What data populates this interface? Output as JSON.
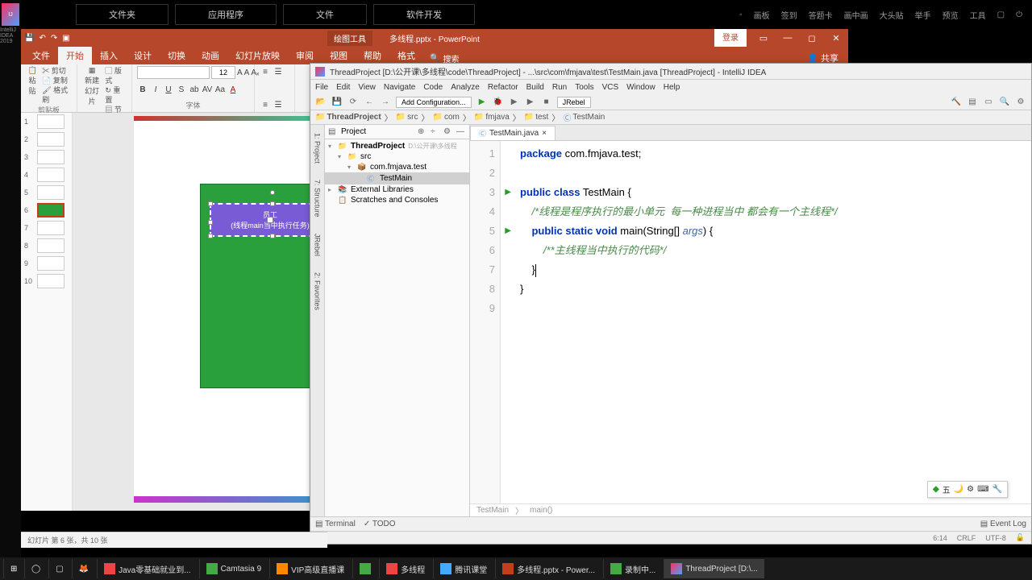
{
  "top_tabs": [
    "文件夹",
    "应用程序",
    "文件",
    "软件开发"
  ],
  "top_right": [
    "画板",
    "签到",
    "答题卡",
    "画中画",
    "大头贴",
    "举手",
    "预览",
    "工具"
  ],
  "ppt": {
    "tools_label": "绘图工具",
    "title": "多线程.pptx - PowerPoint",
    "login": "登录",
    "tabs": [
      "文件",
      "开始",
      "插入",
      "设计",
      "切换",
      "动画",
      "幻灯片放映",
      "审阅",
      "视图",
      "帮助",
      "格式"
    ],
    "search_label": "搜索",
    "share": "共享",
    "ribbon_groups": {
      "paste": "剪贴板",
      "slide": "幻灯片",
      "font": "字体"
    },
    "paste": "粘贴",
    "newslide": "新建\n幻灯片",
    "cut": "剪切",
    "copy": "复制",
    "fmt": "格式刷",
    "layout": "版式",
    "reset": "重置",
    "section": "节",
    "font_size": "12",
    "slide_title": "员工",
    "slide_sub": "(线程main当中执行任务)",
    "status": "幻灯片 第 6 张，共 10 张"
  },
  "idea": {
    "title": "ThreadProject [D:\\公开课\\多线程\\code\\ThreadProject] - ...\\src\\com\\fmjava\\test\\TestMain.java [ThreadProject] - IntelliJ IDEA",
    "menu": [
      "File",
      "Edit",
      "View",
      "Navigate",
      "Code",
      "Analyze",
      "Refactor",
      "Build",
      "Run",
      "Tools",
      "VCS",
      "Window",
      "Help"
    ],
    "add_config": "Add Configuration...",
    "jrebel": "JRebel",
    "breadcrumb": [
      "ThreadProject",
      "src",
      "com",
      "fmjava",
      "test",
      "TestMain"
    ],
    "proj_label": "Project",
    "tree": {
      "root": "ThreadProject",
      "root_path": "D:\\公开课\\多线程",
      "src": "src",
      "pkg": "com.fmjava.test",
      "cls": "TestMain",
      "ext": "External Libraries",
      "scr": "Scratches and Consoles"
    },
    "tab": "TestMain.java",
    "code": {
      "l1a": "package",
      "l1b": "com.fmjava.test",
      "l3a": "public class",
      "l3b": "TestMain",
      "l4": "/*线程是程序执行的最小单元  每一种进程当中 都会有一个主线程*/",
      "l5a": "public static void",
      "l5b": "main",
      "l5c": "String",
      "l5d": "args",
      "l6": "/**主线程当中执行的代码*/"
    },
    "crumbs": [
      "TestMain",
      "main()"
    ],
    "terminal": "Terminal",
    "todo": "TODO",
    "eventlog": "Event Log",
    "status": {
      "pos": "6:14",
      "crlf": "CRLF",
      "enc": "UTF-8"
    },
    "side_tabs": {
      "fav": "2: Favorites",
      "jreb": "JRebel",
      "struct": "7: Structure",
      "proj": "1: Project"
    }
  },
  "ime": "五",
  "taskbar": [
    "Java零基础就业到...",
    "Camtasia 9",
    "VIP高级直播课",
    "多线程",
    "腾讯课堂",
    "多线程.pptx - Power...",
    "录制中...",
    "ThreadProject [D:\\..."
  ],
  "ij_year": "IntelliJ IDEA\n2019"
}
